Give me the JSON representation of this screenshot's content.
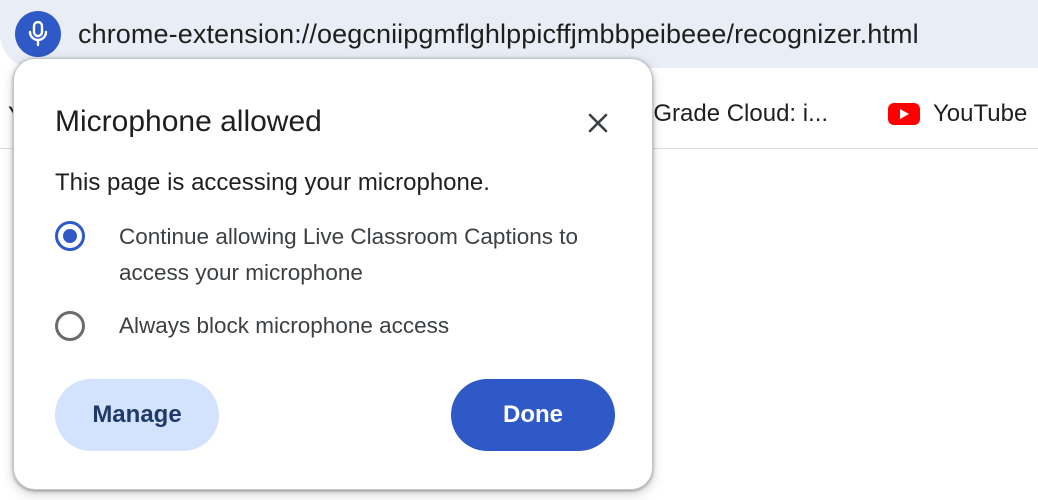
{
  "address_bar": {
    "url": "chrome-extension://oegcniipgmflghlppicffjmbbpeibeee/recognizer.html",
    "icon": "microphone-icon",
    "accent_color": "#2e59c6"
  },
  "bookmarks": {
    "left_stub": "Y",
    "items": [
      {
        "label": "oGrade Cloud: i...",
        "icon": "none"
      },
      {
        "label": "YouTube",
        "icon": "youtube-icon"
      }
    ]
  },
  "popup": {
    "title": "Microphone allowed",
    "description": "This page is accessing your microphone.",
    "close_icon": "close-icon",
    "options": [
      {
        "label": "Continue allowing Live Classroom Captions to access your microphone",
        "checked": true
      },
      {
        "label": "Always block microphone access",
        "checked": false
      }
    ],
    "manage_label": "Manage",
    "done_label": "Done",
    "colors": {
      "primary": "#2e59c6",
      "secondary_bg": "#d3e3fd"
    }
  }
}
